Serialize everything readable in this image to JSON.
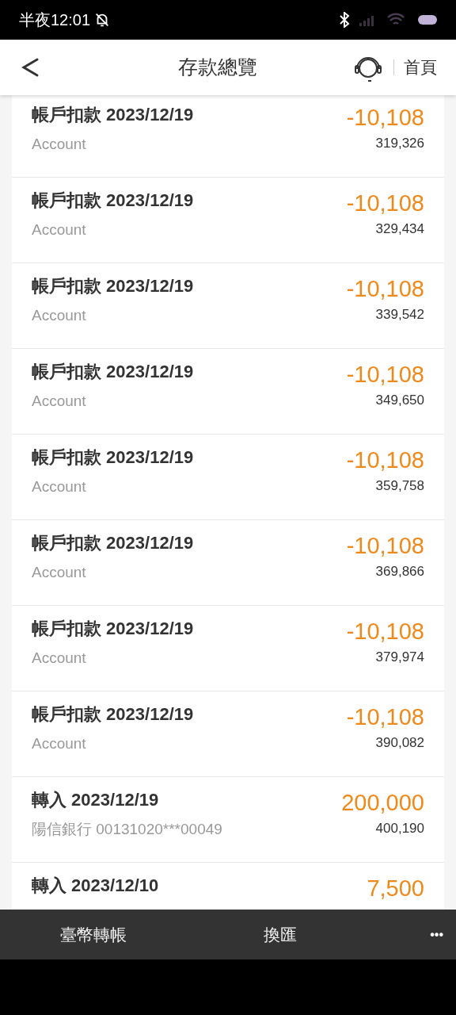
{
  "status_bar": {
    "time": "半夜12:01"
  },
  "header": {
    "title": "存款總覽",
    "home_link": "首頁"
  },
  "transactions": [
    {
      "title": "帳戶扣款 2023/12/19",
      "subtitle": "Account",
      "amount": "-10,108",
      "balance": "319,326"
    },
    {
      "title": "帳戶扣款 2023/12/19",
      "subtitle": "Account",
      "amount": "-10,108",
      "balance": "329,434"
    },
    {
      "title": "帳戶扣款 2023/12/19",
      "subtitle": "Account",
      "amount": "-10,108",
      "balance": "339,542"
    },
    {
      "title": "帳戶扣款 2023/12/19",
      "subtitle": "Account",
      "amount": "-10,108",
      "balance": "349,650"
    },
    {
      "title": "帳戶扣款 2023/12/19",
      "subtitle": "Account",
      "amount": "-10,108",
      "balance": "359,758"
    },
    {
      "title": "帳戶扣款 2023/12/19",
      "subtitle": "Account",
      "amount": "-10,108",
      "balance": "369,866"
    },
    {
      "title": "帳戶扣款 2023/12/19",
      "subtitle": "Account",
      "amount": "-10,108",
      "balance": "379,974"
    },
    {
      "title": "帳戶扣款 2023/12/19",
      "subtitle": "Account",
      "amount": "-10,108",
      "balance": "390,082"
    },
    {
      "title": "轉入 2023/12/19",
      "subtitle": "陽信銀行 00131020***00049",
      "amount": "200,000",
      "balance": "400,190"
    },
    {
      "title": "轉入 2023/12/10",
      "amount": "7,500"
    }
  ],
  "bottom_bar": {
    "items": [
      "臺幣轉帳",
      "換匯"
    ],
    "more": "•••"
  }
}
